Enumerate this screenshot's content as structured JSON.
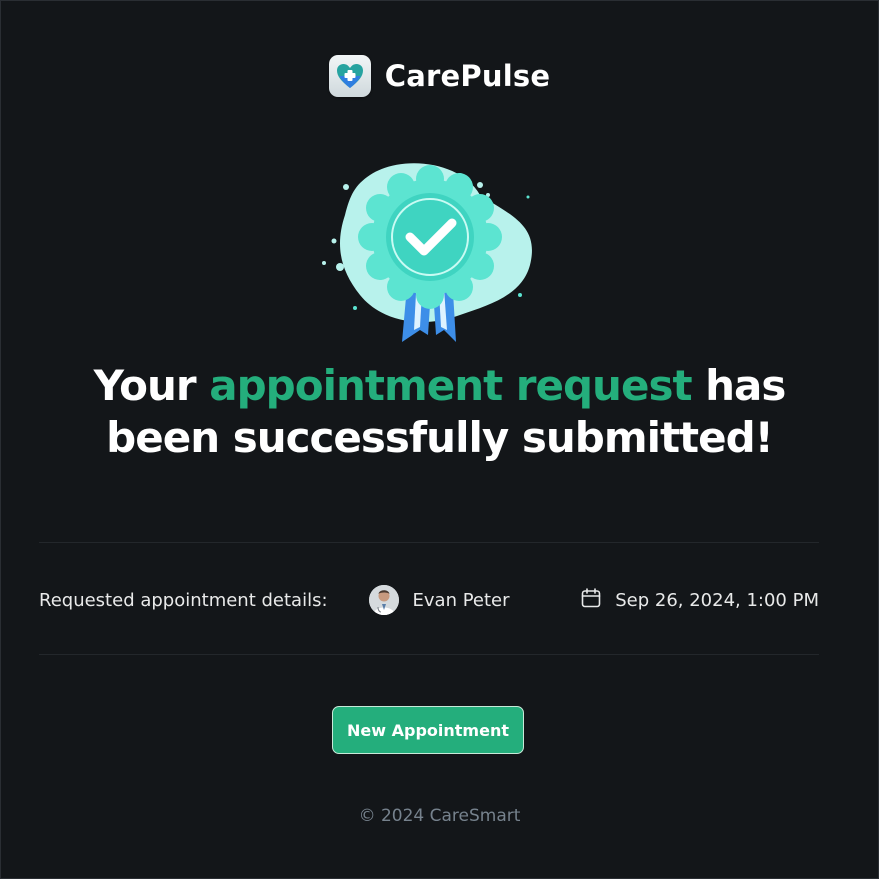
{
  "brand": {
    "name": "CarePulse"
  },
  "success": {
    "headline_before": "Your ",
    "headline_accent": "appointment request",
    "headline_line1_after": " has",
    "headline_line2": "been successfully submitted!"
  },
  "details": {
    "label": "Requested appointment details:",
    "doctor_name": "Evan Peter",
    "datetime": "Sep 26, 2024, 1:00 PM"
  },
  "actions": {
    "new_appointment_label": "New Appointment"
  },
  "footer": {
    "copyright": "© 2024 CareSmart"
  },
  "colors": {
    "accent": "#24ae7c",
    "background": "#131619",
    "badge": "#5ce4d1",
    "ribbon": "#3d8ee8"
  },
  "icons": {
    "logo": "heart-logo-icon",
    "badge": "checkmark-badge-icon",
    "calendar": "calendar-icon"
  }
}
